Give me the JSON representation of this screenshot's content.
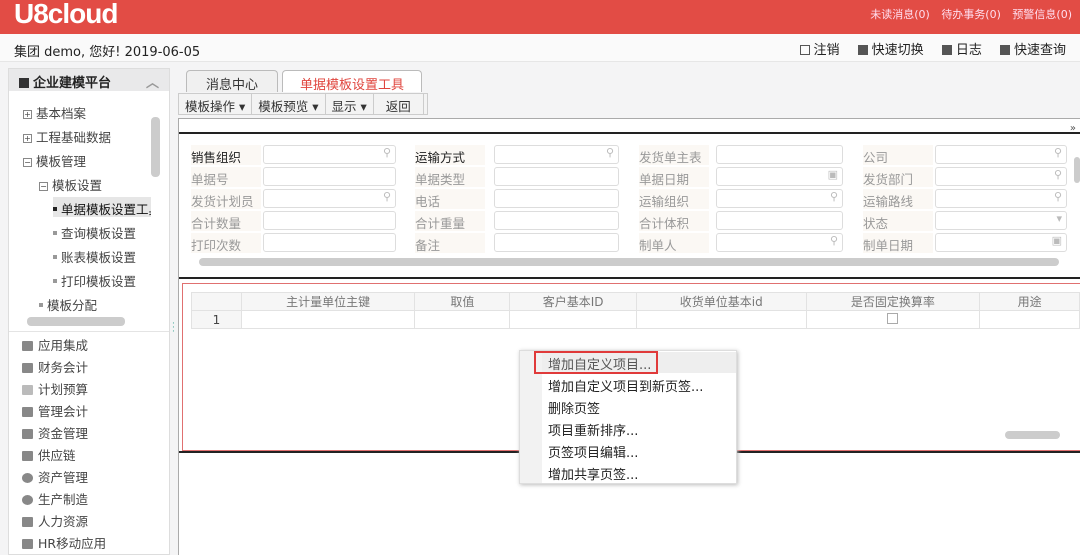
{
  "header": {
    "logo": "U8cloud",
    "links": [
      "未读消息(0)",
      "待办事务(0)",
      "预警信息(0)"
    ]
  },
  "subbar": {
    "greeting": "集团 demo, 您好! 2019-06-05",
    "tools": [
      "注销",
      "快速切换",
      "日志",
      "快速查询"
    ]
  },
  "sidebar": {
    "title": "企业建模平台",
    "tree": [
      {
        "label": "基本档案",
        "state": "+"
      },
      {
        "label": "工程基础数据",
        "state": "+"
      },
      {
        "label": "模板管理",
        "state": "-"
      },
      {
        "label": "模板设置",
        "state": "-"
      },
      {
        "label": "单据模板设置工具"
      },
      {
        "label": "查询模板设置"
      },
      {
        "label": "账表模板设置"
      },
      {
        "label": "打印模板设置"
      },
      {
        "label": "模板分配"
      }
    ],
    "modules": [
      "应用集成",
      "财务会计",
      "计划预算",
      "管理会计",
      "资金管理",
      "供应链",
      "资产管理",
      "生产制造",
      "人力资源",
      "HR移动应用"
    ]
  },
  "tabs": [
    "消息中心",
    "单据模板设置工具"
  ],
  "toolbar": [
    "模板操作 ▾",
    "模板预览 ▾",
    "显示 ▾",
    "返回"
  ],
  "form": {
    "fields": [
      [
        "销售组织",
        "运输方式",
        "发货单主表id",
        "公司"
      ],
      [
        "单据号",
        "单据类型",
        "单据日期",
        "发货部门"
      ],
      [
        "发货计划员",
        "电话",
        "运输组织",
        "运输路线"
      ],
      [
        "合计数量",
        "合计重量",
        "合计体积",
        "状态"
      ],
      [
        "打印次数",
        "备注",
        "制单人",
        "制单日期"
      ]
    ],
    "icons": [
      [
        "search",
        "search",
        "",
        "search"
      ],
      [
        "",
        "",
        "calendar",
        "search"
      ],
      [
        "search",
        "",
        "search",
        "search"
      ],
      [
        "",
        "",
        "",
        "dropdown"
      ],
      [
        "",
        "",
        "search",
        "calendar"
      ]
    ]
  },
  "grid": {
    "columns": [
      "",
      "主计量单位主键",
      "取值",
      "客户基本ID",
      "收货单位基本id",
      "是否固定换算率",
      "用途"
    ],
    "rows": [
      [
        "1",
        "",
        "",
        "",
        "",
        "checkbox",
        ""
      ]
    ]
  },
  "context_menu": {
    "items": [
      "增加自定义项目...",
      "增加自定义项目到新页签...",
      "删除页签",
      "项目重新排序...",
      "页签项目编辑...",
      "增加共享页签..."
    ],
    "highlighted": 0,
    "highlight_color": "#e03a3a"
  }
}
